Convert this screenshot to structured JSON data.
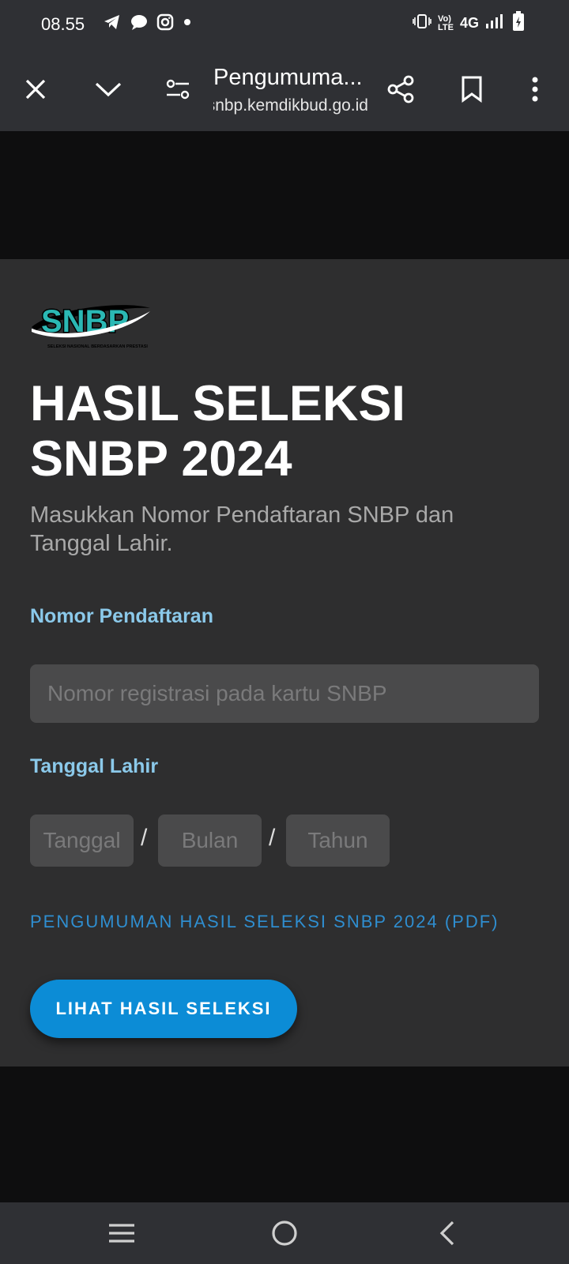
{
  "status_bar": {
    "time": "08.55",
    "network": "4G",
    "volte": "Vo) LTE"
  },
  "toolbar": {
    "page_title": "Pengumuma...",
    "url": "snbp.kemdikbud.go.id"
  },
  "logo": {
    "text": "SNBP",
    "tagline": "SELEKSI NASIONAL BERDASARKAN PRESTASI"
  },
  "main": {
    "title": "HASIL SELEKSI SNBP 2024",
    "subtitle": "Masukkan Nomor Pendaftaran SNBP dan Tanggal Lahir.",
    "registration_label": "Nomor Pendaftaran",
    "registration_placeholder": "Nomor registrasi pada kartu SNBP",
    "birthdate_label": "Tanggal Lahir",
    "day_placeholder": "Tanggal",
    "month_placeholder": "Bulan",
    "year_placeholder": "Tahun",
    "separator": "/",
    "pdf_link": "PENGUMUMAN HASIL SELEKSI SNBP 2024 (PDF)",
    "submit_button": "LIHAT HASIL SELEKSI"
  },
  "colors": {
    "label": "#8bc9ea",
    "link": "#2f8ed0",
    "button": "#0c8cd6",
    "logo_teal": "#2bb8b4"
  },
  "icons": [
    "telegram-icon",
    "chat-icon",
    "instagram-icon",
    "vibrate-icon",
    "signal-icon",
    "battery-icon",
    "close-icon",
    "chevron-down-icon",
    "page-settings-icon",
    "share-icon",
    "bookmark-icon",
    "more-vert-icon",
    "menu-icon",
    "home-icon",
    "back-icon"
  ]
}
